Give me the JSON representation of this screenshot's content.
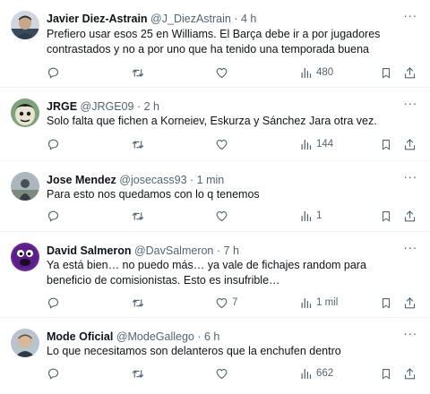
{
  "tweets": [
    {
      "name": "Javier Diez-Astrain",
      "handle": "@J_DiezAstrain",
      "dot": "·",
      "time": "4 h",
      "text": "Prefiero usar esos 25 en Williams. El Barça debe ir a por jugadores contrastados y no a por uno que ha tenido una temporada buena",
      "replies": "",
      "retweets": "",
      "likes": "",
      "views": "480",
      "avatar_icon": "person-photo-avatar",
      "avatar_colors": [
        "#3a4a5c",
        "#c9a58a"
      ]
    },
    {
      "name": "JRGE",
      "handle": "@JRGE09",
      "dot": "·",
      "time": "2 h",
      "text": "Solo falta que fichen a Korneiev, Eskurza y Sánchez Jara otra vez.",
      "replies": "",
      "retweets": "",
      "likes": "",
      "views": "144",
      "avatar_icon": "cartoon-character-avatar",
      "avatar_colors": [
        "#7fa37a",
        "#e9e3d2"
      ]
    },
    {
      "name": "Jose Mendez",
      "handle": "@josecass93",
      "dot": "·",
      "time": "1 min",
      "text": "Para esto nos quedamos con lo q tenemos",
      "replies": "",
      "retweets": "",
      "likes": "",
      "views": "1",
      "avatar_icon": "outdoor-photo-avatar",
      "avatar_colors": [
        "#aab7bf",
        "#4a4f55"
      ]
    },
    {
      "name": "David Salmeron",
      "handle": "@DavSalmeron",
      "dot": "·",
      "time": "7 h",
      "text": "Ya está bien… no puedo más… ya vale de fichajes random para beneficio de comisionistas. Esto es insufrible…",
      "replies": "",
      "retweets": "",
      "likes": "7",
      "views": "1 mil",
      "avatar_icon": "purple-monster-avatar",
      "avatar_colors": [
        "#5b1f86",
        "#ffffff"
      ]
    },
    {
      "name": "Mode Oficial",
      "handle": "@ModeGallego",
      "dot": "·",
      "time": "6 h",
      "text": "Lo que necesitamos son delanteros que la enchufen dentro",
      "replies": "",
      "retweets": "",
      "likes": "",
      "views": "662",
      "avatar_icon": "person-photo-avatar",
      "avatar_colors": [
        "#b9c4cc",
        "#d8b79a"
      ]
    }
  ],
  "colors": {
    "text": "#0f1419",
    "secondary": "#536471",
    "divider": "#eff3f4"
  }
}
